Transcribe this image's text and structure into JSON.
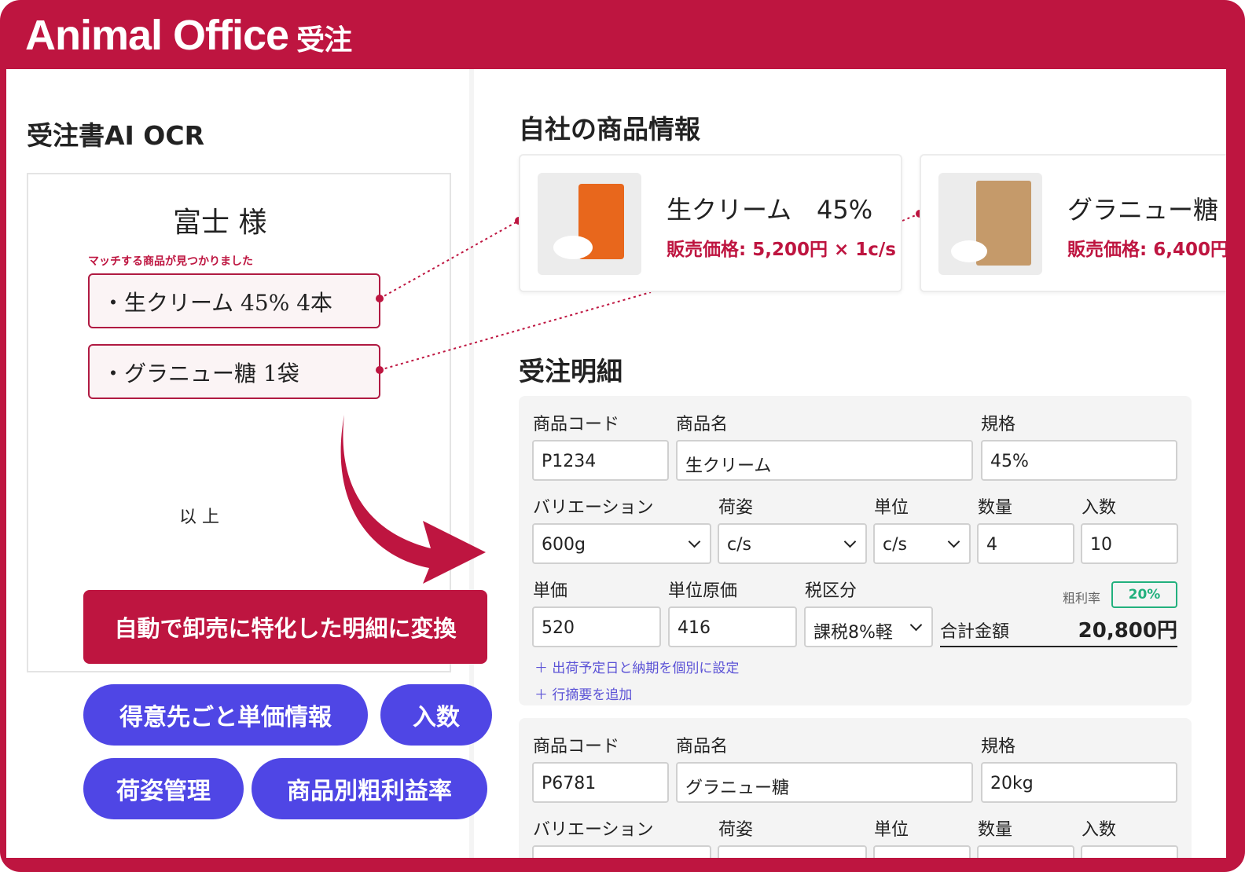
{
  "app": {
    "title": "Animal Office",
    "title_suffix": "受注"
  },
  "ocr": {
    "heading": "受注書AI OCR",
    "customer": "富士 様",
    "match_note": "マッチする商品が見つかりました",
    "lines": [
      "・生クリーム 45% 4本",
      "・グラニュー糖 1袋"
    ],
    "footer": "以 上",
    "convert_button": "自動で卸売に特化した明細に変換"
  },
  "features": [
    "得意先ごと単価情報",
    "入数",
    "荷姿管理",
    "商品別粗利益率"
  ],
  "products": {
    "heading": "自社の商品情報",
    "items": [
      {
        "name": "生クリーム　45%",
        "price": "販売価格: 5,200円 × 1c/s"
      },
      {
        "name": "グラニュー糖",
        "price": "販売価格: 6,400円"
      }
    ]
  },
  "details": {
    "heading": "受注明細",
    "labels": {
      "code": "商品コード",
      "name": "商品名",
      "spec": "規格",
      "variation": "バリエーション",
      "packing": "荷姿",
      "unit": "単位",
      "qty": "数量",
      "per_case": "入数",
      "price": "単価",
      "cost": "単位原価",
      "tax": "税区分",
      "margin": "粗利率",
      "total": "合計金額"
    },
    "rows": [
      {
        "code": "P1234",
        "name": "生クリーム",
        "spec": "45%",
        "variation": "600g",
        "packing": "c/s",
        "unit": "c/s",
        "qty": "4",
        "per_case": "10",
        "price": "520",
        "cost": "416",
        "tax": "課税8%軽",
        "margin": "20%",
        "total": "20,800円"
      },
      {
        "code": "P6781",
        "name": "グラニュー糖",
        "spec": "20kg"
      }
    ],
    "links": [
      "＋ 出荷予定日と納期を個別に設定",
      "＋ 行摘要を追加"
    ]
  },
  "colors": {
    "brand": "#be1540",
    "accent": "#4f46e5",
    "margin": "#22b07d"
  }
}
